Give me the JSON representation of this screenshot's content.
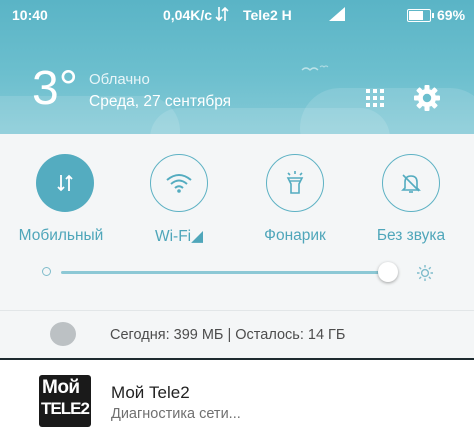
{
  "status_bar": {
    "time": "10:40",
    "net_speed": "0,04K/c",
    "carrier": "Tele2",
    "network_type": "H",
    "battery_percent": "69%",
    "battery_level": 0.69
  },
  "weather": {
    "temperature": "3°",
    "condition": "Облачно",
    "date": "Среда, 27 сентября"
  },
  "header_buttons": {
    "apps_icon": "grid-apps-icon",
    "settings_icon": "gear-icon"
  },
  "toggles": [
    {
      "label": "Мобильный",
      "icon": "data-transfer-icon",
      "state": "on"
    },
    {
      "label": "Wi-Fi◢",
      "icon": "wifi-icon",
      "state": "off"
    },
    {
      "label": "Фонарик",
      "icon": "flashlight-icon",
      "state": "off"
    },
    {
      "label": "Без звука",
      "icon": "bell-off-icon",
      "state": "off"
    }
  ],
  "brightness": {
    "level": 0.98
  },
  "data_usage": {
    "text": "Сегодня: 399 МБ | Осталось: 14 ГБ"
  },
  "notification": {
    "icon_line1": "Мой",
    "icon_line2": "TELE2",
    "app_name": "Мой Tele2",
    "subtitle": "Диагностика сети..."
  },
  "colors": {
    "header_bg": "#5ab4c6",
    "accent": "#54acc0",
    "panel_bg": "#f4f6f7"
  }
}
